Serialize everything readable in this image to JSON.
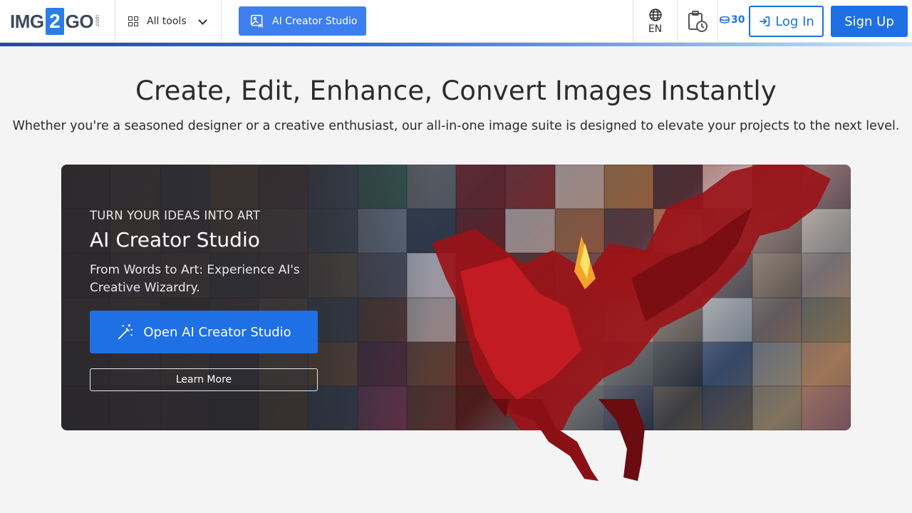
{
  "header": {
    "logo": {
      "prefix": "IMG",
      "number": "2",
      "suffix": "GO",
      "domain": ".com"
    },
    "all_tools_label": "All tools",
    "ai_button_label": "AI Creator Studio",
    "language_label": "EN",
    "credits_count": "30",
    "login_label": "Log In",
    "signup_label": "Sign Up",
    "icons": [
      "grid-icon",
      "chevron-down-icon",
      "image-ai-icon",
      "globe-icon",
      "clipboard-clock-icon",
      "coins-icon",
      "login-arrow-icon"
    ]
  },
  "hero": {
    "title": "Create, Edit, Enhance, Convert Images Instantly",
    "subtitle": "Whether you're a seasoned designer or a creative enthusiast, our all-in-one image suite is designed to elevate your projects to the next level."
  },
  "banner": {
    "eyebrow": "TURN YOUR IDEAS INTO ART",
    "title": "AI Creator Studio",
    "description": "From Words to Art: Experience AI's Creative Wizardry.",
    "primary_button": "Open AI Creator Studio",
    "secondary_button": "Learn More",
    "icons": [
      "magic-wand-icon"
    ]
  },
  "colors": {
    "primary": "#1f6fe5",
    "ai_button": "#3d7fef",
    "background": "#f4f4f4",
    "text": "#2b2b2b",
    "dragon": "#b8141c"
  }
}
